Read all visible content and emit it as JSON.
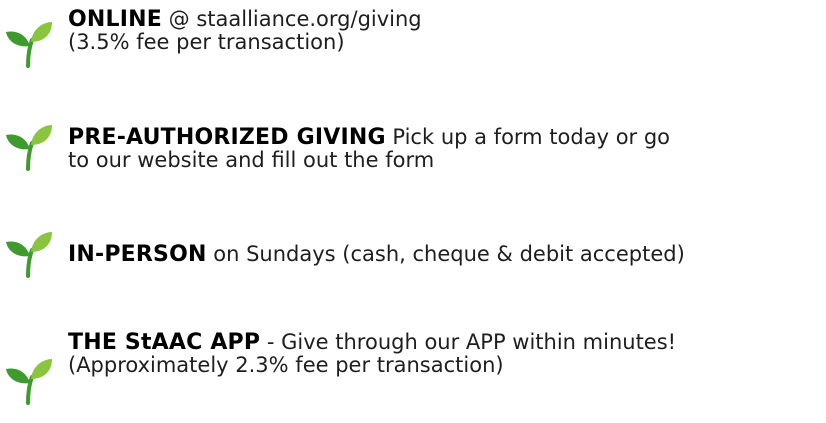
{
  "colors": {
    "sprout_dark": "#3f9b2e",
    "sprout_light": "#8bc43f",
    "text": "#1e1e1e",
    "heading": "#000000"
  },
  "items": [
    {
      "icon": "sprout-icon",
      "heading": "ONLINE",
      "line1_rest": " @ staalliance.org/giving",
      "line2": "(3.5% fee per transaction)"
    },
    {
      "icon": "sprout-icon",
      "heading": "PRE-AUTHORIZED GIVING",
      "line1_rest": " Pick up a form today or go",
      "line2": "to our website and fill out the form"
    },
    {
      "icon": "sprout-icon",
      "heading": "IN-PERSON",
      "line1_rest": " on Sundays (cash, cheque & debit accepted)",
      "line2": ""
    },
    {
      "icon": "sprout-icon",
      "heading": "THE StAAC APP",
      "line1_rest": " - Give through our APP within minutes!",
      "line2": "(Approximately 2.3% fee per transaction)"
    }
  ]
}
